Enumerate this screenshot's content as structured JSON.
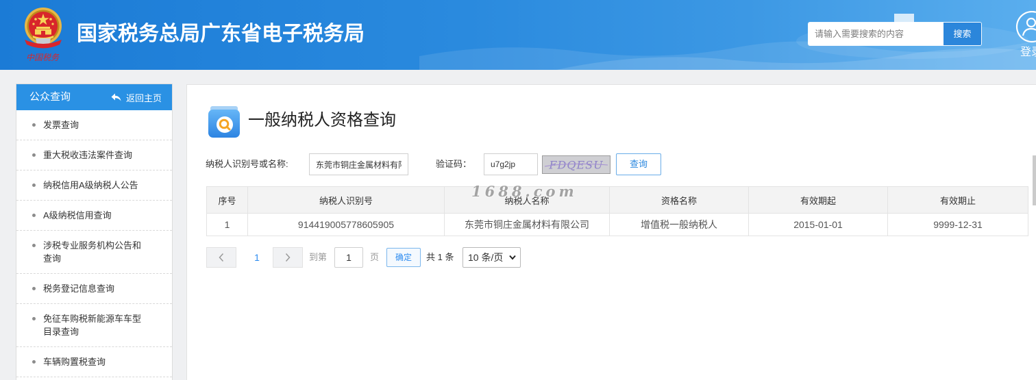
{
  "header": {
    "title": "国家税务总局广东省电子税务局",
    "emblem_caption": "中国税务",
    "search": {
      "placeholder": "请输入需要搜索的内容",
      "button_label": "搜索"
    },
    "login_label": "登录"
  },
  "sidebar": {
    "title": "公众查询",
    "back_label": "返回主页",
    "items": [
      "发票查询",
      "重大税收违法案件查询",
      "纳税信用A级纳税人公告",
      "A级纳税信用查询",
      "涉税专业服务机构公告和查询",
      "税务登记信息查询",
      "免征车购税新能源车车型目录查询",
      "车辆购置税查询"
    ]
  },
  "main": {
    "title": "一般纳税人资格查询",
    "form": {
      "taxpayer_label": "纳税人识别号或名称:",
      "taxpayer_value": "东莞市铜庄金属材料有限",
      "captcha_label": "验证码：",
      "captcha_value": "u7g2jp",
      "captcha_image_text": "FDQESU",
      "query_button": "查询"
    },
    "watermark": "1688.com",
    "table": {
      "columns": [
        "序号",
        "纳税人识别号",
        "纳税人名称",
        "资格名称",
        "有效期起",
        "有效期止"
      ],
      "rows": [
        [
          "1",
          "914419005778605905",
          "东莞市铜庄金属材料有限公司",
          "增值税一般纳税人",
          "2015-01-01",
          "9999-12-31"
        ]
      ]
    },
    "pagination": {
      "current_page": "1",
      "goto_prefix": "到第",
      "goto_value": "1",
      "goto_suffix": "页",
      "confirm_label": "确定",
      "total_text": "共 1 条",
      "page_size": "10 条/页"
    }
  },
  "icons": {
    "back": "back-arrow-icon",
    "search": "magnifier-icon",
    "user": "user-icon",
    "prev": "chevron-left-icon",
    "next": "chevron-right-icon",
    "dropdown": "chevron-down-icon"
  },
  "colors": {
    "header_start": "#1b7bd6",
    "header_end": "#5aaeee",
    "sidebar_header": "#2a91e4",
    "link_blue": "#2d8cf0",
    "emblem_red": "#d8262b"
  }
}
